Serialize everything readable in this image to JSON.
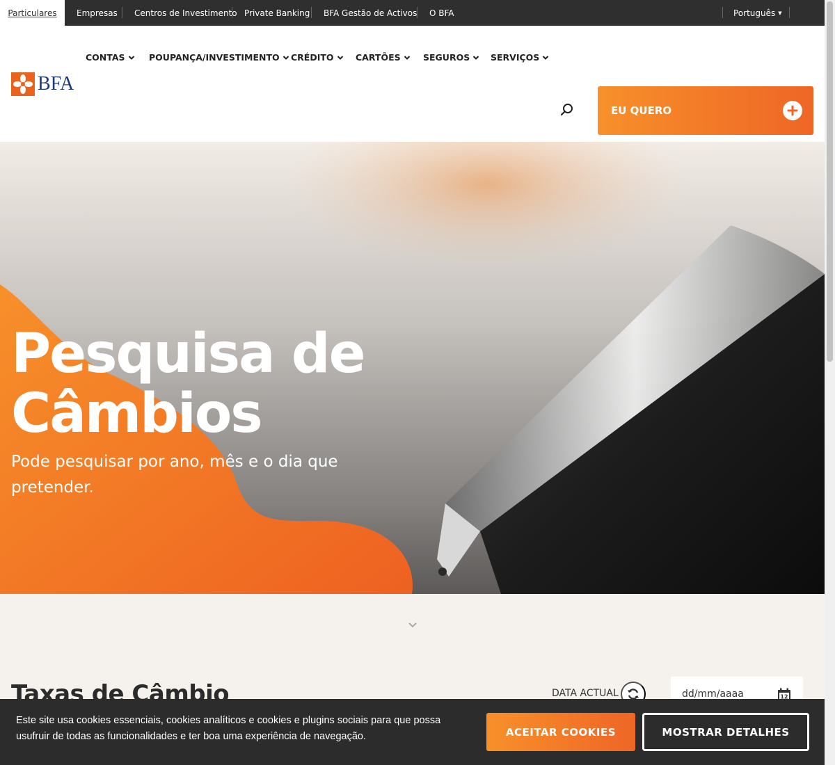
{
  "topbar": {
    "tabs": [
      {
        "label": "Particulares",
        "active": true
      },
      {
        "label": "Empresas"
      },
      {
        "label": "Centros de Investimento"
      },
      {
        "label": "Private Banking"
      },
      {
        "label": "BFA Gestão de Activos"
      },
      {
        "label": "O BFA"
      }
    ],
    "language": "Português"
  },
  "header": {
    "logo_text": "BFA",
    "nav": [
      {
        "label": "CONTAS"
      },
      {
        "label": "POUPANÇA/INVESTIMENTO"
      },
      {
        "label": "CRÉDITO"
      },
      {
        "label": "CARTÕES"
      },
      {
        "label": "SEGUROS"
      },
      {
        "label": "SERVIÇOS"
      }
    ],
    "cta_label": "EU QUERO",
    "icons": {
      "search": "search-icon",
      "plus": "plus-icon",
      "chevron": "chevron-down-icon"
    }
  },
  "hero": {
    "title_line1": "Pesquisa de",
    "title_line2": "Câmbios",
    "subtitle": "Pode pesquisar por ano, mês e o dia que pretender."
  },
  "rates": {
    "title": "Taxas de Câmbio",
    "current_date_label": "DATA ACTUAL",
    "date_placeholder": "dd/mm/aaaa",
    "calendar_day": "12"
  },
  "cookie": {
    "text": "Este site usa cookies essenciais, cookies analíticos e cookies e plugins sociais para que possa usufruir de todas as funcionalidades e ter boa uma experiência de navegação.",
    "accept_label": "ACEITAR COOKIES",
    "details_label": "MOSTRAR DETALHES"
  },
  "colors": {
    "accent_orange": "#ee6626",
    "accent_orange_light": "#f7902a",
    "topbar_bg": "#2f2f2f",
    "brand_blue": "#1d3a7a",
    "cookie_bg": "#2c2c2c"
  }
}
